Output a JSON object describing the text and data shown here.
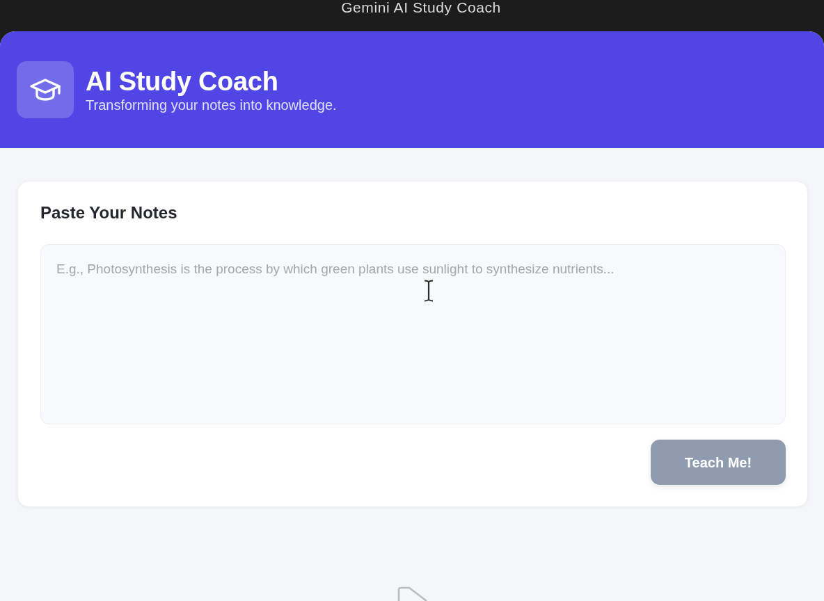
{
  "window": {
    "title": "Gemini AI Study Coach"
  },
  "header": {
    "title": "AI Study Coach",
    "subtitle": "Transforming your notes into knowledge."
  },
  "notes_card": {
    "heading": "Paste Your Notes",
    "notes_field": {
      "placeholder": "E.g., Photosynthesis is the process by which green plants use sunlight to synthesize nutrients..."
    },
    "submit_button": {
      "label": "Teach Me!",
      "disabled": true
    }
  }
}
